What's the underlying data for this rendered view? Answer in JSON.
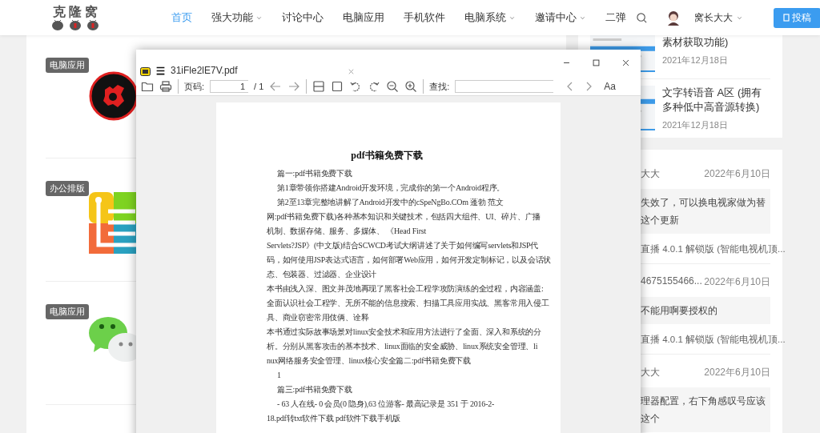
{
  "site_header": {
    "logo": "克 隆 窝",
    "nav": [
      {
        "label": "首页",
        "selected": true,
        "has_menu": false
      },
      {
        "label": "强大功能",
        "selected": false,
        "has_menu": true
      },
      {
        "label": "讨论中心",
        "selected": false,
        "has_menu": false
      },
      {
        "label": "电脑应用",
        "selected": false,
        "has_menu": false
      },
      {
        "label": "手机软件",
        "selected": false,
        "has_menu": false
      },
      {
        "label": "电脑系统",
        "selected": false,
        "has_menu": true
      },
      {
        "label": "邀请中心",
        "selected": false,
        "has_menu": true
      },
      {
        "label": "二弹",
        "selected": false,
        "has_menu": false
      }
    ],
    "user": "窝长大大",
    "post_button": "投稿"
  },
  "posts": [
    {
      "tag": "电脑应用",
      "kind": "gear"
    },
    {
      "tag": "办公排版",
      "kind": "tiles"
    },
    {
      "tag": "电脑应用",
      "kind": "chat"
    }
  ],
  "sidebar_articles": [
    {
      "title": "素材获取功能)",
      "date": "2021年12月18日"
    },
    {
      "title": "文字转语音 A区 (拥有多种低中高音源转换)",
      "date": "2021年12月18日"
    }
  ],
  "comments": [
    {
      "author": "大大",
      "date": "2022年6月10日",
      "text_lines": [
        "失效了，可以换电视家做为替",
        "这个更新"
      ],
      "post": "直播 4.0.1 解锁版 (智能电视机顶..."
    },
    {
      "author": "4675155466...",
      "date": "2022年6月10日",
      "text_lines": [
        "不能用啊要授权的"
      ],
      "post": "直播 4.0.1 解锁版 (智能电视机顶..."
    },
    {
      "author": "大大",
      "date": "2022年6月10日",
      "text_lines": [
        "理器配置，右下角感叹号应该",
        "这个"
      ]
    }
  ],
  "pdf_viewer": {
    "title": "31iFle2lE7V.pdf",
    "page_label": "页码:",
    "page": "1",
    "page_total": "/ 1",
    "find_label": "查找:",
    "font_button": "Aa",
    "document": {
      "heading": "pdf书籍免费下载",
      "lines": [
        {
          "text": "篇一:pdf书籍免费下载",
          "indent": true
        },
        {
          "text": "第1章带领你搭建Android开发环境，完成你的第一个Android程序。",
          "indent": true
        },
        {
          "text": "第2至13章完整地讲解了Android开发中的cSpeNgBo.COm 蓬勃 范文",
          "indent": true
        },
        {
          "text": "网:pdf书籍免费下载)各种基本知识和关键技术，包括四大组件、UI、碎片、广播",
          "indent": false
        },
        {
          "text": "机制、数据存储、服务、多媒体、 《Head First",
          "indent": false
        },
        {
          "text": "Servlets?JSP》(中文版)结合SCWCD考试大纲讲述了关于如何编写servlets和JSP代",
          "indent": false
        },
        {
          "text": "码，如何使用JSP表达式语言，如何部署Web应用，如何开发定制标记，以及会话状",
          "indent": false
        },
        {
          "text": "态、包装器、过滤器、企业设计",
          "indent": false
        },
        {
          "text": "本书由浅入深、图文并茂地再现了黑客社会工程学攻防演练的全过程，内容涵盖:",
          "indent": false
        },
        {
          "text": "全面认识社会工程学、无所不能的信息搜索、扫描工具应用实战、黑客常用入侵工",
          "indent": false
        },
        {
          "text": "具、商业窃密常用伎俩、诠释",
          "indent": false
        },
        {
          "text": "本书通过实际故事场景对linux安全技术和应用方法进行了全面、深入和系统的分",
          "indent": false
        },
        {
          "text": "析。分别从黑客攻击的基本技术、linux面临的安全威胁、linux系统安全管理、li",
          "indent": false
        },
        {
          "text": "nux网络服务安全管理、linux核心安全篇二:pdf书籍免费下载",
          "indent": false
        },
        {
          "text": "1",
          "indent": true
        },
        {
          "text": "篇三:pdf书籍免费下载",
          "indent": true
        },
        {
          "text": "- 63 人在线- 0 会员(0 隐身),63 位游客- 最高记录是 351 于 2016-2-",
          "indent": true
        },
        {
          "text": "18.pdf转txt软件下载 pdf软件下载手机版",
          "indent": false
        }
      ]
    }
  }
}
